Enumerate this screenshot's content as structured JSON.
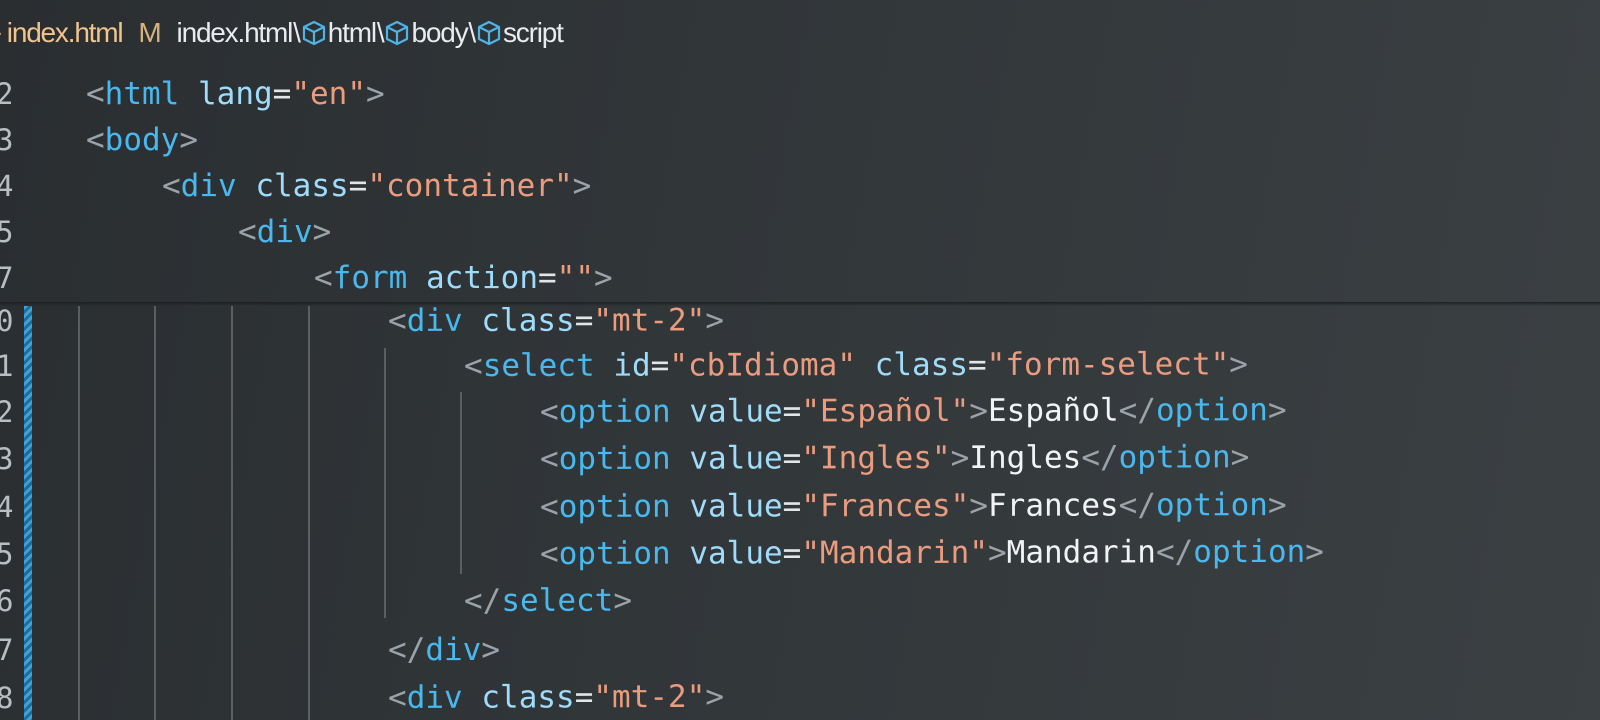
{
  "breadcrumb": {
    "chevron": "›",
    "file": "index.html",
    "modified_flag": "M",
    "path_root": "index.html",
    "separator": "\\",
    "segments": [
      "html",
      "body",
      "script"
    ],
    "segment_icon": "cube-icon"
  },
  "editor": {
    "lines": [
      {
        "no": "2",
        "tokens": [
          [
            "br",
            "<"
          ],
          [
            "tag",
            "html"
          ],
          [
            "sp",
            " "
          ],
          [
            "attr",
            "lang"
          ],
          [
            "eq",
            "="
          ],
          [
            "str",
            "\"en\""
          ],
          [
            "br",
            ">"
          ]
        ]
      },
      {
        "no": "3",
        "tokens": [
          [
            "br",
            "<"
          ],
          [
            "tag",
            "body"
          ],
          [
            "br",
            ">"
          ]
        ]
      },
      {
        "no": "4",
        "tokens": [
          [
            "br",
            "<"
          ],
          [
            "tag",
            "div"
          ],
          [
            "sp",
            " "
          ],
          [
            "attr",
            "class"
          ],
          [
            "eq",
            "="
          ],
          [
            "str",
            "\"container\""
          ],
          [
            "br",
            ">"
          ]
        ]
      },
      {
        "no": "5",
        "tokens": [
          [
            "br",
            "<"
          ],
          [
            "tag",
            "div"
          ],
          [
            "br",
            ">"
          ]
        ]
      },
      {
        "no": "7",
        "tokens": [
          [
            "br",
            "<"
          ],
          [
            "tag",
            "form"
          ],
          [
            "sp",
            " "
          ],
          [
            "attr",
            "action"
          ],
          [
            "eq",
            "="
          ],
          [
            "str",
            "\"\""
          ],
          [
            "br",
            ">"
          ]
        ]
      },
      {
        "no": "0",
        "tokens": [
          [
            "br",
            "<"
          ],
          [
            "tag",
            "div"
          ],
          [
            "sp",
            " "
          ],
          [
            "attr",
            "class"
          ],
          [
            "eq",
            "="
          ],
          [
            "str",
            "\"mt-2\""
          ],
          [
            "br",
            ">"
          ]
        ]
      },
      {
        "no": "1",
        "tokens": [
          [
            "br",
            "<"
          ],
          [
            "tag",
            "select"
          ],
          [
            "sp",
            " "
          ],
          [
            "attr",
            "id"
          ],
          [
            "eq",
            "="
          ],
          [
            "str",
            "\"cbIdioma\""
          ],
          [
            "sp",
            " "
          ],
          [
            "attr",
            "class"
          ],
          [
            "eq",
            "="
          ],
          [
            "str",
            "\"form-select\""
          ],
          [
            "br",
            ">"
          ]
        ]
      },
      {
        "no": "2",
        "tokens": [
          [
            "br",
            "<"
          ],
          [
            "tag",
            "option"
          ],
          [
            "sp",
            " "
          ],
          [
            "attr",
            "value"
          ],
          [
            "eq",
            "="
          ],
          [
            "str",
            "\"Español\""
          ],
          [
            "br",
            ">"
          ],
          [
            "txt",
            "Español"
          ],
          [
            "br",
            "</"
          ],
          [
            "tag",
            "option"
          ],
          [
            "br",
            ">"
          ]
        ]
      },
      {
        "no": "3",
        "tokens": [
          [
            "br",
            "<"
          ],
          [
            "tag",
            "option"
          ],
          [
            "sp",
            " "
          ],
          [
            "attr",
            "value"
          ],
          [
            "eq",
            "="
          ],
          [
            "str",
            "\"Ingles\""
          ],
          [
            "br",
            ">"
          ],
          [
            "txt",
            "Ingles"
          ],
          [
            "br",
            "</"
          ],
          [
            "tag",
            "option"
          ],
          [
            "br",
            ">"
          ]
        ]
      },
      {
        "no": "4",
        "tokens": [
          [
            "br",
            "<"
          ],
          [
            "tag",
            "option"
          ],
          [
            "sp",
            " "
          ],
          [
            "attr",
            "value"
          ],
          [
            "eq",
            "="
          ],
          [
            "str",
            "\"Frances\""
          ],
          [
            "br",
            ">"
          ],
          [
            "txt",
            "Frances"
          ],
          [
            "br",
            "</"
          ],
          [
            "tag",
            "option"
          ],
          [
            "br",
            ">"
          ]
        ]
      },
      {
        "no": "5",
        "tokens": [
          [
            "br",
            "<"
          ],
          [
            "tag",
            "option"
          ],
          [
            "sp",
            " "
          ],
          [
            "attr",
            "value"
          ],
          [
            "eq",
            "="
          ],
          [
            "str",
            "\"Mandarin\""
          ],
          [
            "br",
            ">"
          ],
          [
            "txt",
            "Mandarin"
          ],
          [
            "br",
            "</"
          ],
          [
            "tag",
            "option"
          ],
          [
            "br",
            ">"
          ]
        ]
      },
      {
        "no": "6",
        "tokens": [
          [
            "br",
            "</"
          ],
          [
            "tag",
            "select"
          ],
          [
            "br",
            ">"
          ]
        ]
      },
      {
        "no": "7",
        "tokens": [
          [
            "br",
            "</"
          ],
          [
            "tag",
            "div"
          ],
          [
            "br",
            ">"
          ]
        ]
      },
      {
        "no": "8",
        "tokens": [
          [
            "br",
            "<"
          ],
          [
            "tag",
            "div"
          ],
          [
            "sp",
            " "
          ],
          [
            "attr",
            "class"
          ],
          [
            "eq",
            "="
          ],
          [
            "str",
            "\"mt-2\""
          ],
          [
            "br",
            ">"
          ]
        ]
      }
    ]
  },
  "colors": {
    "background": "#2d3134",
    "tag": "#48b8ee",
    "attribute": "#9fdcfb",
    "string": "#eb9c7e",
    "text": "#f1f3f4",
    "bracket": "#9aa3aa",
    "modified_gutter": "#3fa1d8",
    "breadcrumb_file": "#f1c48c"
  }
}
